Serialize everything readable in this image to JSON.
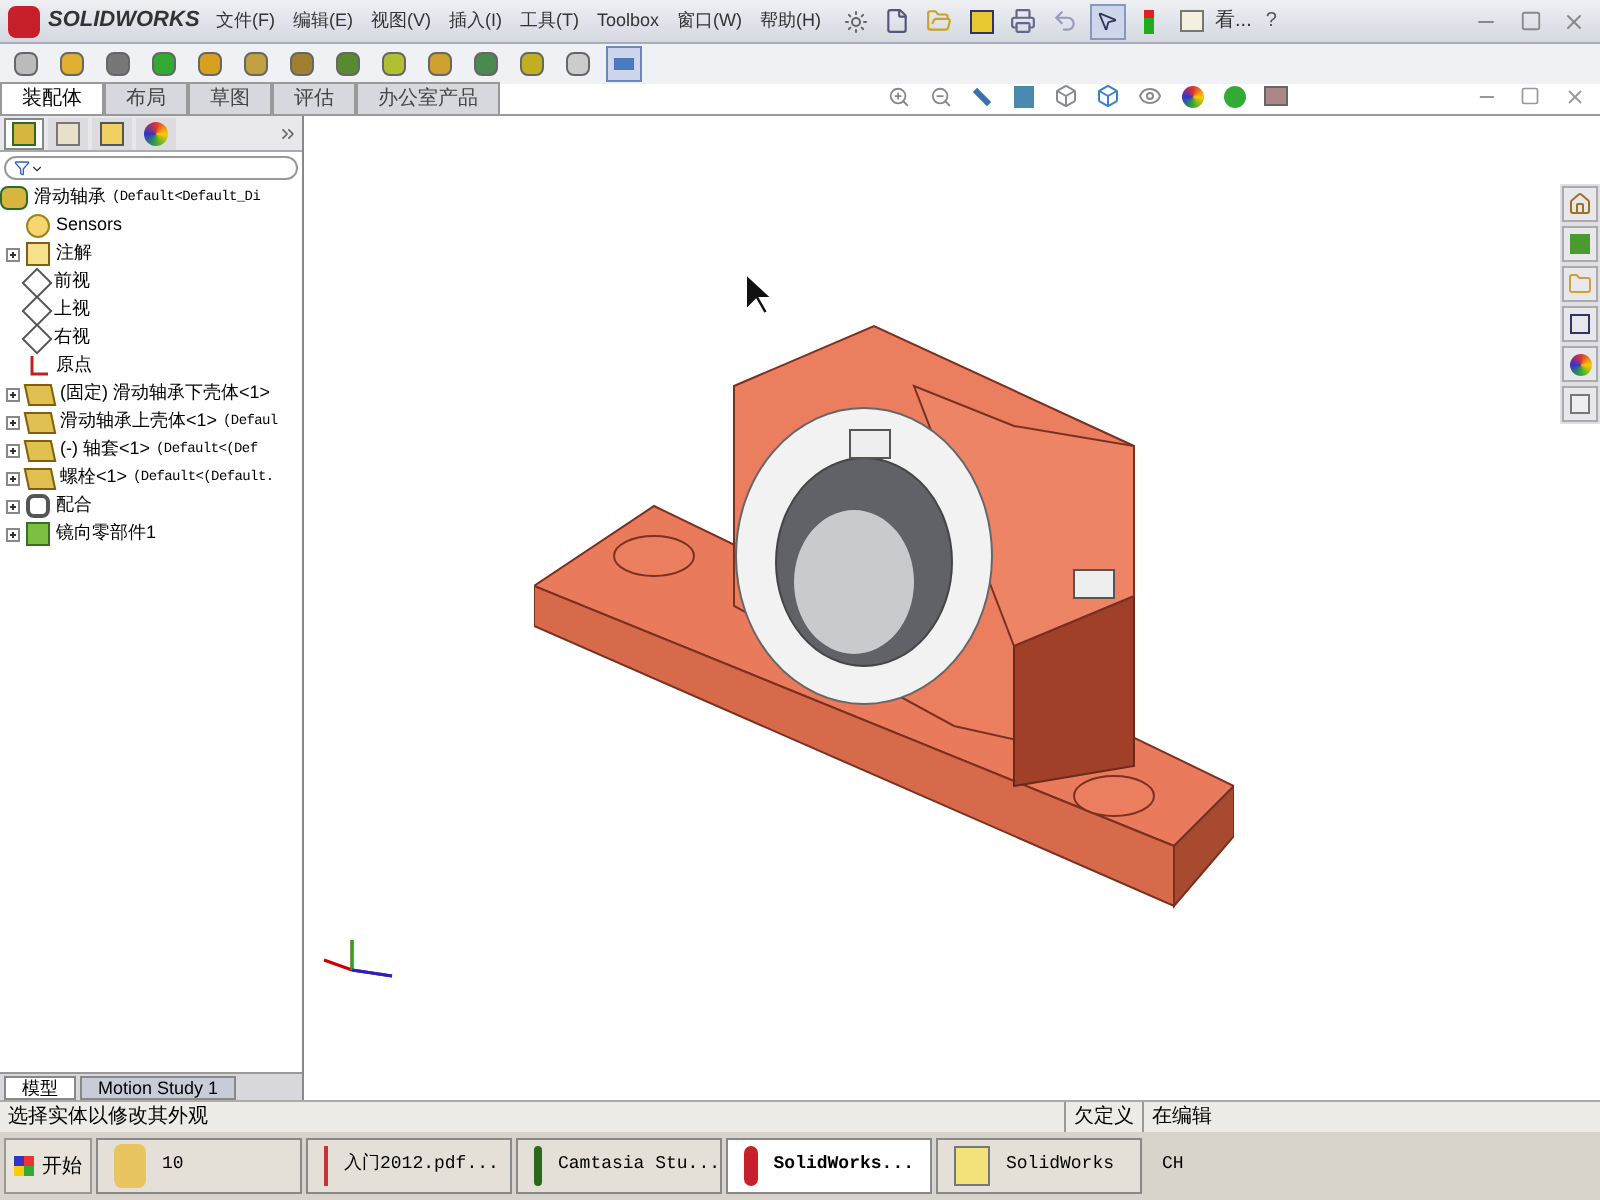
{
  "app": {
    "logo": "SOLIDWORKS"
  },
  "menu": [
    {
      "label": "文件(F)"
    },
    {
      "label": "编辑(E)"
    },
    {
      "label": "视图(V)"
    },
    {
      "label": "插入(I)"
    },
    {
      "label": "工具(T)"
    },
    {
      "label": "Toolbox"
    },
    {
      "label": "窗口(W)"
    },
    {
      "label": "帮助(H)"
    }
  ],
  "search": {
    "label": "看..."
  },
  "help": {
    "label": "?"
  },
  "command_tabs": [
    {
      "label": "装配体",
      "selected": true
    },
    {
      "label": "布局",
      "selected": false
    },
    {
      "label": "草图",
      "selected": false
    },
    {
      "label": "评估",
      "selected": false
    },
    {
      "label": "办公室产品",
      "selected": false
    }
  ],
  "panel_tabs": [
    {
      "kind": "tree",
      "selected": true
    },
    {
      "kind": "properties",
      "selected": false
    },
    {
      "kind": "config",
      "selected": false
    },
    {
      "kind": "appearance",
      "selected": false
    }
  ],
  "tree": [
    {
      "label": "滑动轴承",
      "suffix": "(Default<Default_Di",
      "kind": "assembly",
      "children": [
        {
          "label": "Sensors",
          "kind": "sensor"
        },
        {
          "label": "注解",
          "kind": "annotation",
          "expanded": false
        },
        {
          "label": "前视",
          "kind": "plane"
        },
        {
          "label": "上视",
          "kind": "plane"
        },
        {
          "label": "右视",
          "kind": "plane"
        },
        {
          "label": "原点",
          "kind": "origin"
        },
        {
          "label": "(固定) 滑动轴承下壳体<1>",
          "kind": "part",
          "expanded": false
        },
        {
          "label": "滑动轴承上壳体<1>",
          "suffix": "(Defaul",
          "kind": "part",
          "expanded": false
        },
        {
          "label": "(-) 轴套<1>",
          "suffix": "(Default<(Def",
          "kind": "part",
          "expanded": false
        },
        {
          "label": "螺栓<1>",
          "suffix": "(Default<(Default.",
          "kind": "part",
          "expanded": false
        },
        {
          "label": "配合",
          "kind": "mates",
          "expanded": false
        },
        {
          "label": "镜向零部件1",
          "kind": "mirror",
          "expanded": false
        }
      ]
    }
  ],
  "bottom_tabs": [
    {
      "label": "模型",
      "selected": true
    },
    {
      "label": "Motion Study 1",
      "selected": false
    }
  ],
  "status_bar": {
    "message": "选择实体以修改其外观",
    "fields": [
      "欠定义",
      "在编辑"
    ]
  },
  "taskbar": {
    "start": "开始",
    "items": [
      {
        "label": "10",
        "kind": "folder",
        "selected": false
      },
      {
        "label": "入门2012.pdf...",
        "kind": "pdf",
        "selected": false
      },
      {
        "label": "Camtasia Stu...",
        "kind": "camtasia",
        "selected": false
      },
      {
        "label": "SolidWorks...",
        "kind": "solidworks",
        "selected": true
      },
      {
        "label": "SolidWorks",
        "kind": "help",
        "selected": false
      }
    ],
    "language": "CH"
  }
}
